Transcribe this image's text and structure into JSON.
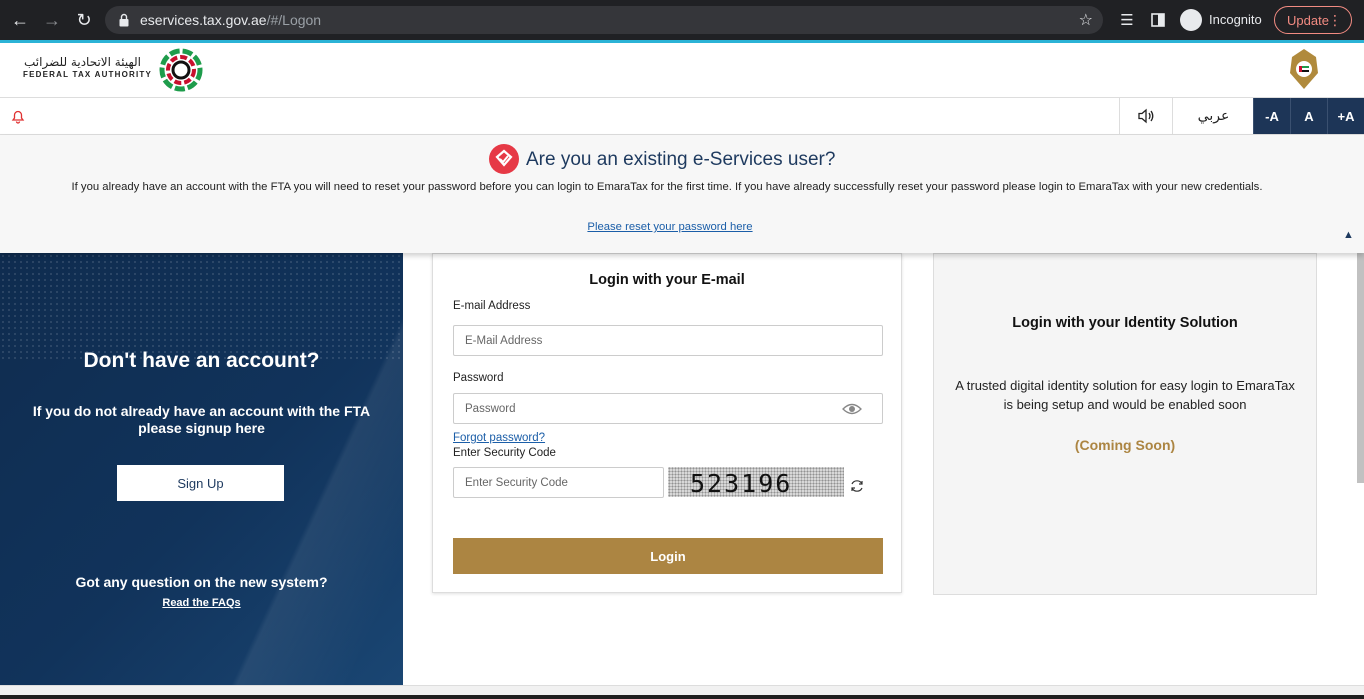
{
  "browser": {
    "url_host": "eservices.tax.gov.ae",
    "url_rest": "/#/Logon",
    "incognito_label": "Incognito",
    "update_label": "Update"
  },
  "header": {
    "logo_arabic": "الهيئة الاتحادية للضرائب",
    "logo_english": "FEDERAL TAX AUTHORITY"
  },
  "toolbar": {
    "arabic_label": "عربي",
    "font_decrease": "-A",
    "font_normal": "A",
    "font_increase": "+A"
  },
  "notice": {
    "title": "Are you an existing e-Services user?",
    "text": "If you already have an account with the FTA you will need to reset your password before you can login to EmaraTax for the first time. If you have already successfully reset your password please login to EmaraTax with your new credentials.",
    "link": "Please reset your password here"
  },
  "left_panel": {
    "title": "Don't have an account?",
    "description": "If you do not already have an account with the FTA please signup here",
    "signup_label": "Sign Up",
    "question": "Got any question on the new system?",
    "faq_link": "Read the FAQs"
  },
  "login": {
    "title": "Login with your E-mail",
    "email_label": "E-mail Address",
    "email_placeholder": "E-Mail Address",
    "password_label": "Password",
    "password_placeholder": "Password",
    "forgot_link": "Forgot password?",
    "security_label": "Enter Security Code",
    "security_placeholder": "Enter Security Code",
    "captcha_code": "523196",
    "login_label": "Login"
  },
  "identity": {
    "title": "Login with your Identity Solution",
    "description": "A trusted digital identity solution for easy login to EmaraTax is being setup and would be enabled soon",
    "coming_soon": "(Coming Soon)"
  },
  "colors": {
    "navy": "#1d3557",
    "gold": "#ac8542",
    "link": "#1b5ea8",
    "accent": "#2bb3d6"
  }
}
